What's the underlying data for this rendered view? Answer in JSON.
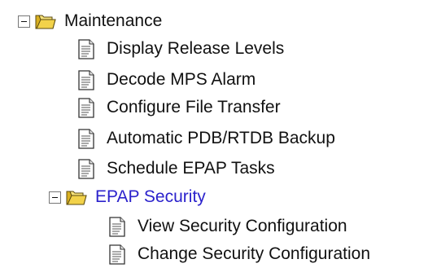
{
  "tree": {
    "root": {
      "label": "Maintenance",
      "state": "expanded",
      "children": [
        {
          "label": "Display Release Levels"
        },
        {
          "label": "Decode MPS Alarm"
        },
        {
          "label": "Configure File Transfer"
        },
        {
          "label": "Automatic PDB/RTDB Backup"
        },
        {
          "label": "Schedule EPAP Tasks"
        }
      ],
      "subfolder": {
        "label": "EPAP Security",
        "state": "expanded",
        "children": [
          {
            "label": "View Security Configuration"
          },
          {
            "label": "Change Security Configuration"
          }
        ]
      }
    }
  },
  "colors": {
    "text": "#111111",
    "link": "#2b22cc",
    "folder_fill": "#f2d24a",
    "background": "#ffffff"
  },
  "icons": {
    "toggle": "collapse-toggle-icon",
    "folder": "open-folder-icon",
    "document": "document-icon"
  }
}
